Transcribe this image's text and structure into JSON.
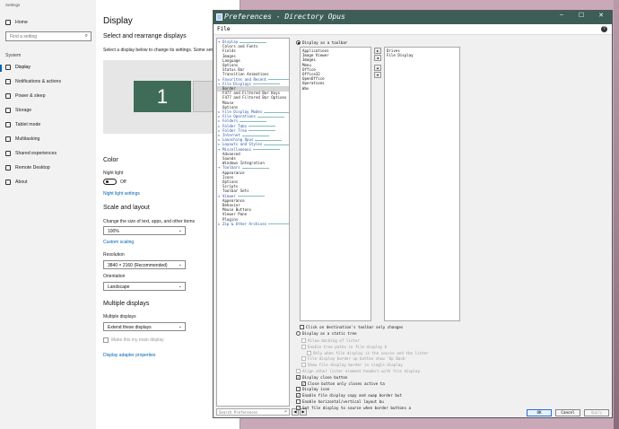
{
  "settings": {
    "window_title": "Settings",
    "nav": {
      "home": "Home",
      "search_placeholder": "Find a setting",
      "section": "System",
      "items": [
        "Display",
        "Notifications & actions",
        "Power & sleep",
        "Storage",
        "Tablet mode",
        "Multitasking",
        "Shared experiences",
        "Remote Desktop",
        "About"
      ]
    },
    "main": {
      "title": "Display",
      "rearrange_heading": "Select and rearrange displays",
      "rearrange_text": "Select a display below to change its settings. Some setti",
      "monitor_label": "1",
      "color_heading": "Color",
      "night_light_label": "Night light",
      "night_light_state": "Off",
      "night_light_settings": "Night light settings",
      "scale_heading": "Scale and layout",
      "scale_text": "Change the size of text, apps, and other items",
      "scale_value": "100%",
      "custom_scaling": "Custom scaling",
      "resolution_label": "Resolution",
      "resolution_value": "3840 × 2160 (Recommended)",
      "orientation_label": "Orientation",
      "orientation_value": "Landscape",
      "multiple_heading": "Multiple displays",
      "multiple_label": "Multiple displays",
      "multiple_value": "Extend these displays",
      "main_display_label": "Make this my main display",
      "adapter_link": "Display adapter properties"
    }
  },
  "dopus": {
    "title": "Preferences - Directory Opus",
    "menu_file": "File",
    "help": "?",
    "tree": [
      {
        "label": "Display",
        "type": "cat",
        "expanded": true
      },
      {
        "label": "Colors and Fonts",
        "type": "item"
      },
      {
        "label": "Fields",
        "type": "item"
      },
      {
        "label": "Images",
        "type": "item"
      },
      {
        "label": "Language",
        "type": "item"
      },
      {
        "label": "Options",
        "type": "item"
      },
      {
        "label": "Status Bar",
        "type": "item"
      },
      {
        "label": "Transition Animations",
        "type": "item"
      },
      {
        "label": "Favorites and Recent",
        "type": "cat"
      },
      {
        "label": "File Displays",
        "type": "cat",
        "expanded": true
      },
      {
        "label": "Border",
        "type": "item",
        "selected": true
      },
      {
        "label": "F477 and Filtered Bar Keys",
        "type": "item"
      },
      {
        "label": "F477 and Filtered Bar Options",
        "type": "item"
      },
      {
        "label": "Mouse",
        "type": "item"
      },
      {
        "label": "Options",
        "type": "item"
      },
      {
        "label": "File Display Modes",
        "type": "cat"
      },
      {
        "label": "File Operations",
        "type": "cat"
      },
      {
        "label": "Folders",
        "type": "cat"
      },
      {
        "label": "Folder Tabs",
        "type": "cat"
      },
      {
        "label": "Folder Tree",
        "type": "cat"
      },
      {
        "label": "Internet",
        "type": "cat"
      },
      {
        "label": "Launching Opus",
        "type": "cat"
      },
      {
        "label": "Layouts and Styles",
        "type": "cat"
      },
      {
        "label": "Miscellaneous",
        "type": "cat",
        "expanded": true
      },
      {
        "label": "Advanced",
        "type": "item"
      },
      {
        "label": "Sounds",
        "type": "item"
      },
      {
        "label": "Windows Integration",
        "type": "item"
      },
      {
        "label": "Toolbars",
        "type": "cat",
        "expanded": true
      },
      {
        "label": "Appearance",
        "type": "item"
      },
      {
        "label": "Icons",
        "type": "item"
      },
      {
        "label": "Options",
        "type": "item"
      },
      {
        "label": "Scripts",
        "type": "item"
      },
      {
        "label": "Toolbar Sets",
        "type": "item"
      },
      {
        "label": "Viewer",
        "type": "cat",
        "expanded": true
      },
      {
        "label": "Appearance",
        "type": "item"
      },
      {
        "label": "Behavior",
        "type": "item"
      },
      {
        "label": "Mouse Buttons",
        "type": "item"
      },
      {
        "label": "Viewer Pane",
        "type": "item"
      },
      {
        "label": "Plugins",
        "type": "item"
      },
      {
        "label": "Zip & Other Archives",
        "type": "cat"
      }
    ],
    "search_placeholder": "Search Preferences",
    "panel": {
      "toolbar_radio": "Display as a toolbar",
      "available": [
        "Applications",
        "Image Viewer",
        "Images",
        "Menu",
        "Office",
        "Office32",
        "OpenOffice",
        "Operations",
        "Wav"
      ],
      "selected": [
        "Drives",
        "File Display"
      ],
      "click_dest": "Click on destination's toolbar only changes",
      "static_radio": "Display as a static tree",
      "options": [
        {
          "label": "Allow docking of lister",
          "checked": false,
          "enabled": false,
          "indent": 1
        },
        {
          "label": "Enable tree paths in file display b",
          "checked": false,
          "enabled": false,
          "indent": 1
        },
        {
          "label": "Only when file display is the source and the lister",
          "checked": false,
          "enabled": false,
          "indent": 2
        },
        {
          "label": "File display border up button show 'Up Back'",
          "checked": false,
          "enabled": false,
          "indent": 1
        },
        {
          "label": "Show file display border in single display",
          "checked": false,
          "enabled": false,
          "indent": 1
        },
        {
          "label": "Align other lister element headers with file display",
          "checked": false,
          "enabled": false,
          "indent": 0
        },
        {
          "label": "Display close button",
          "checked": true,
          "enabled": true,
          "indent": 0
        },
        {
          "label": "Close button only closes active ta",
          "checked": true,
          "enabled": true,
          "indent": 1
        },
        {
          "label": "Display icon",
          "checked": false,
          "enabled": true,
          "indent": 0
        },
        {
          "label": "Enable file display copy and swap border but",
          "checked": true,
          "enabled": true,
          "indent": 0
        },
        {
          "label": "Enable horizontal/vertical layout bu",
          "checked": false,
          "enabled": true,
          "indent": 0
        },
        {
          "label": "Set file display to source when border buttons a",
          "checked": true,
          "enabled": true,
          "indent": 0
        }
      ]
    },
    "buttons": {
      "ok": "OK",
      "cancel": "Cancel",
      "apply": "Apply"
    }
  }
}
